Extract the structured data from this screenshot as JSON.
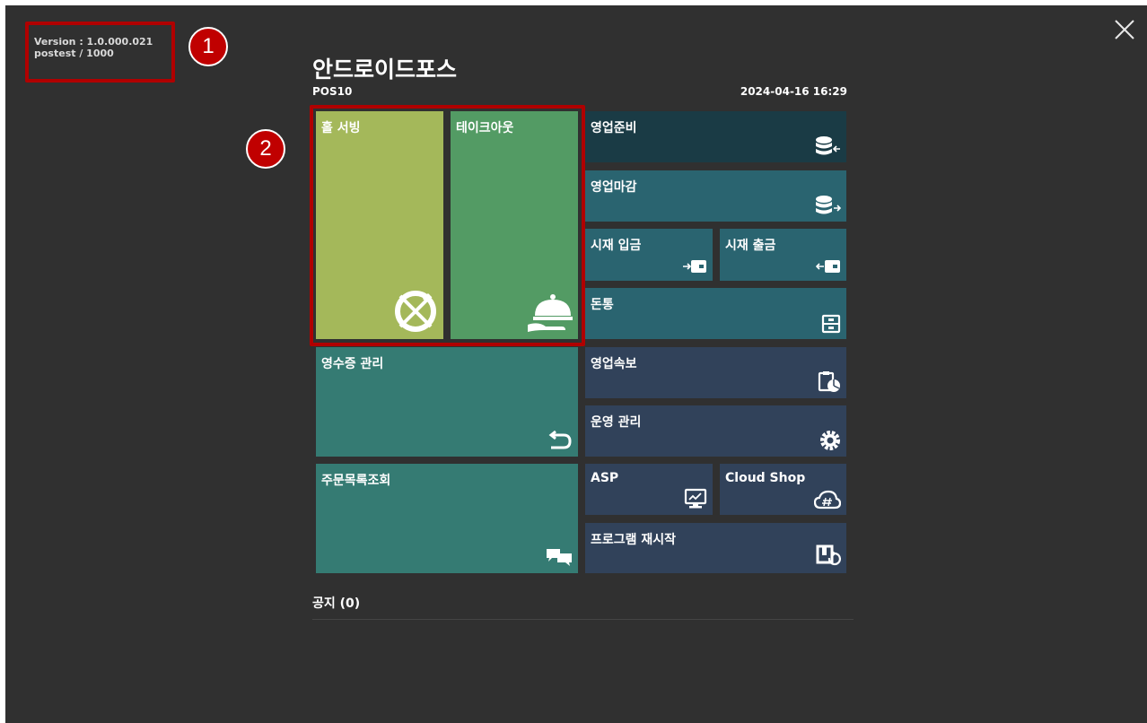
{
  "version_info": {
    "version": "Version : 1.0.000.021",
    "user": "postest / 1000"
  },
  "annotations": {
    "badge1": "1",
    "badge2": "2",
    "color": "#c00000"
  },
  "header": {
    "title": "안드로이드포스",
    "pos_id": "POS10",
    "datetime": "2024-04-16 16:29"
  },
  "tiles": {
    "hall_serving": {
      "label": "홀 서빙",
      "icon": "plate-fork-knife-icon",
      "color": "#a4b85a"
    },
    "takeout": {
      "label": "테이크아웃",
      "icon": "cloche-serving-icon",
      "color": "#539b64"
    },
    "business_open": {
      "label": "영업준비",
      "icon": "database-in-icon",
      "color": "#1a3b45"
    },
    "business_close": {
      "label": "영업마감",
      "icon": "database-out-icon",
      "color": "#2a6470"
    },
    "cash_deposit": {
      "label": "시재 입금",
      "icon": "wallet-in-icon",
      "color": "#2a6470"
    },
    "cash_withdraw": {
      "label": "시재 출금",
      "icon": "wallet-out-icon",
      "color": "#2a6470"
    },
    "cash_drawer": {
      "label": "돈통",
      "icon": "cash-drawer-icon",
      "color": "#2a6470"
    },
    "receipt_mgmt": {
      "label": "영수증 관리",
      "icon": "return-arrow-icon",
      "color": "#357b73"
    },
    "sales_report": {
      "label": "영업속보",
      "icon": "clipboard-chart-icon",
      "color": "#31425a"
    },
    "operation_mgmt": {
      "label": "운영 관리",
      "icon": "gear-icon",
      "color": "#31425a"
    },
    "asp": {
      "label": "ASP",
      "icon": "monitor-icon",
      "color": "#31425a"
    },
    "cloud_shop": {
      "label": "Cloud Shop",
      "icon": "cloud-hash-icon",
      "color": "#31425a"
    },
    "order_list": {
      "label": "주문목록조회",
      "icon": "chat-bubbles-icon",
      "color": "#357b73"
    },
    "restart": {
      "label": "프로그램 재시작",
      "icon": "restart-icon",
      "color": "#31425a"
    }
  },
  "notice": {
    "label": "공지 (0)"
  }
}
